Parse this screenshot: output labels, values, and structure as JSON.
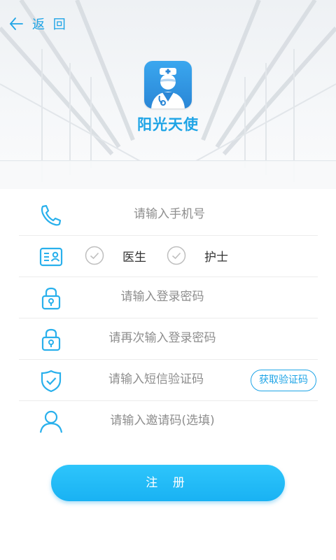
{
  "header": {
    "back_label": "返 回"
  },
  "app": {
    "name": "阳光天使"
  },
  "form": {
    "phone_placeholder": "请输入手机号",
    "roles": [
      {
        "label": "医生"
      },
      {
        "label": "护士"
      }
    ],
    "password_placeholder": "请输入登录密码",
    "confirm_password_placeholder": "请再次输入登录密码",
    "sms_code_placeholder": "请输入短信验证码",
    "get_code_label": "获取验证码",
    "invite_code_placeholder": "请输入邀请码(选填)",
    "submit_label": "注 册"
  },
  "colors": {
    "accent": "#1ea4e6",
    "button": "#1cb6f5",
    "icon": "#29b0ec"
  }
}
